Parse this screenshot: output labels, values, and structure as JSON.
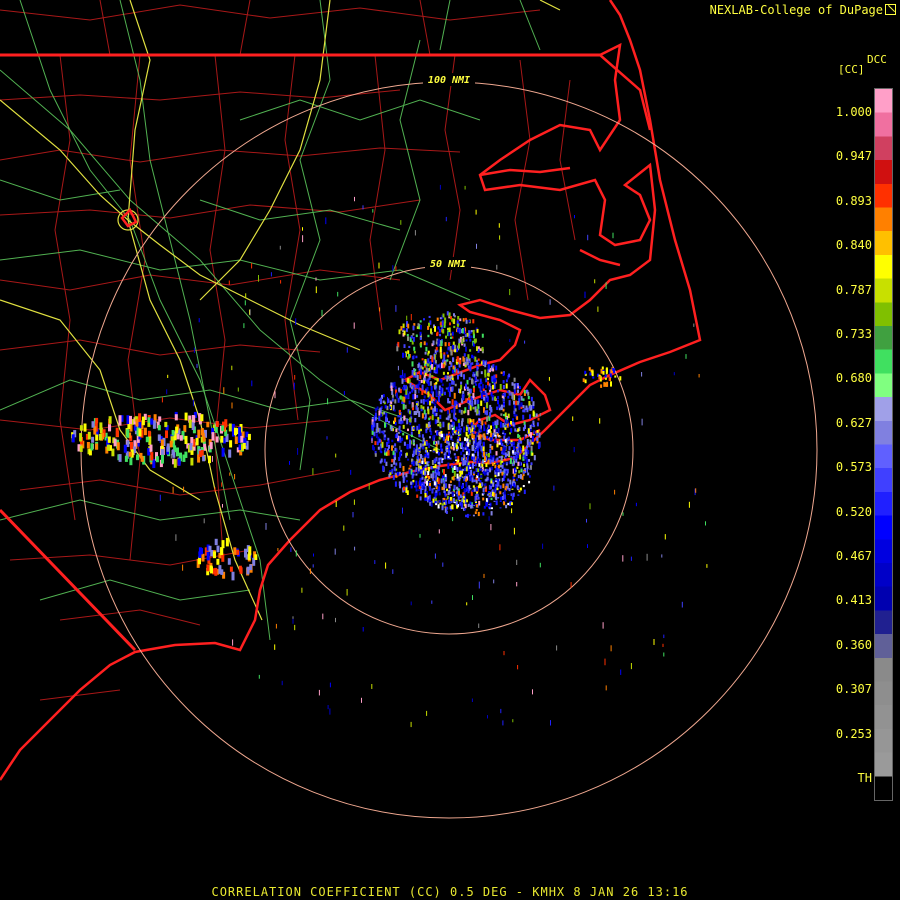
{
  "credit": "NEXLAB-College of DuPage",
  "product": {
    "code": "DCC",
    "unit": "[CC]",
    "footer": "CORRELATION COEFFICIENT (CC) 0.5 DEG - KMHX 8 JAN 26 13:16"
  },
  "range_rings": [
    {
      "label": "50 NMI"
    },
    {
      "label": "100 NMI"
    }
  ],
  "legend": {
    "ticks": [
      "1.000",
      "0.947",
      "0.893",
      "0.840",
      "0.787",
      "0.733",
      "0.680",
      "0.627",
      "0.573",
      "0.520",
      "0.467",
      "0.413",
      "0.360",
      "0.307",
      "0.253",
      "TH"
    ],
    "colors": [
      "#ff9fc8",
      "#f070a0",
      "#d04060",
      "#d01010",
      "#ff3000",
      "#ff8000",
      "#ffc000",
      "#ffff00",
      "#c8e000",
      "#80c000",
      "#40a040",
      "#40e060",
      "#80ff80",
      "#a0a0e8",
      "#8080e0",
      "#6060ff",
      "#4040ff",
      "#2020ff",
      "#0000ff",
      "#0000e0",
      "#0000c8",
      "#0000b0",
      "#202090",
      "#606098",
      "#8a8a8a",
      "#8e8e8e",
      "#929292",
      "#969696",
      "#9a9a9a",
      "#000000"
    ]
  },
  "colors": {
    "state_borders": "#ff2020",
    "county_lines": "#b01818",
    "highways": "#60d060",
    "interstates": "#e0e040",
    "range_rings": "#f0a890",
    "labels": "#ffff40"
  }
}
